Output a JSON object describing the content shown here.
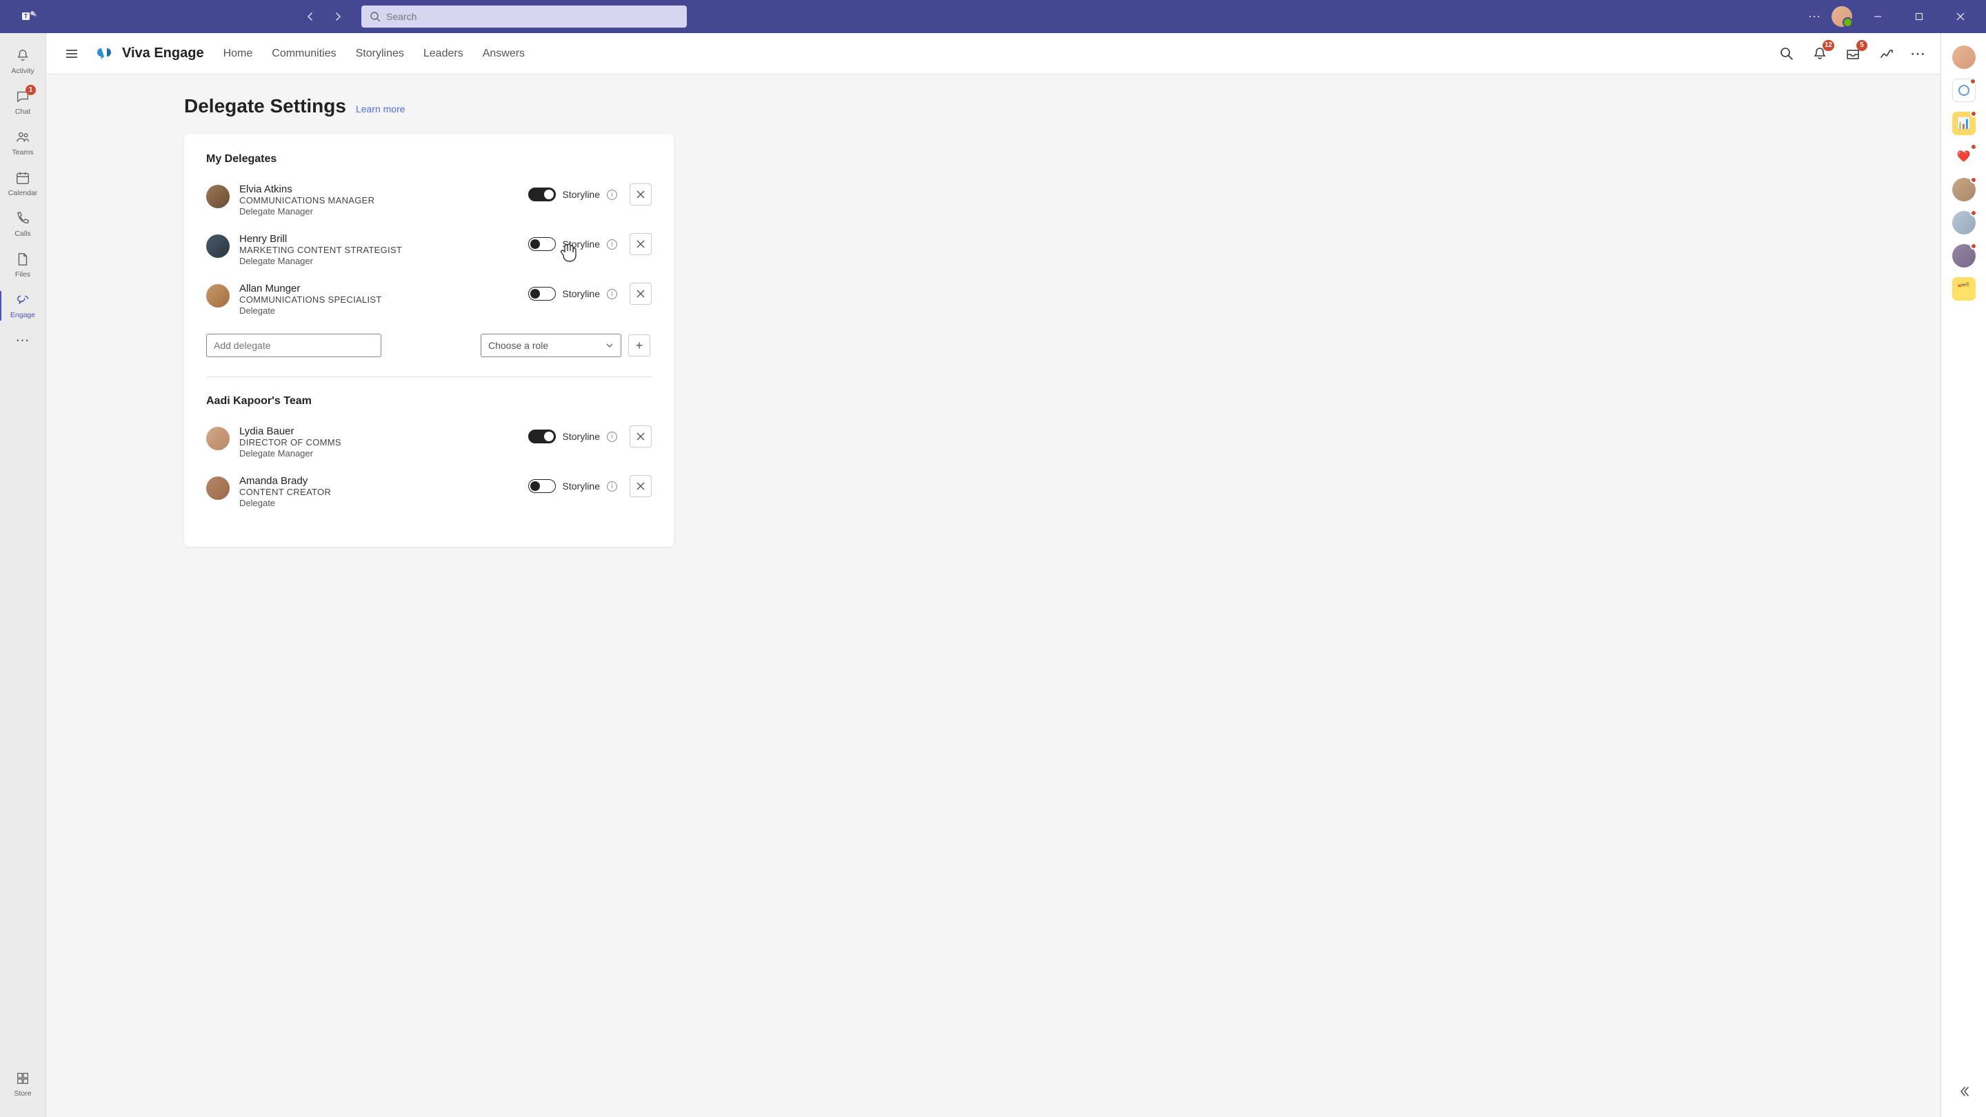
{
  "search": {
    "placeholder": "Search"
  },
  "rail": {
    "activity": "Activity",
    "chat": "Chat",
    "chat_badge": "1",
    "teams": "Teams",
    "calendar": "Calendar",
    "calls": "Calls",
    "files": "Files",
    "engage": "Engage",
    "store": "Store"
  },
  "header": {
    "app_title": "Viva Engage",
    "nav": {
      "home": "Home",
      "communities": "Communities",
      "storylines": "Storylines",
      "leaders": "Leaders",
      "answers": "Answers"
    },
    "bell_badge": "12",
    "inbox_badge": "5"
  },
  "page": {
    "title": "Delegate Settings",
    "learn_more": "Learn more"
  },
  "sections": {
    "my_delegates": "My Delegates",
    "team_title": "Aadi Kapoor's Team"
  },
  "delegates": [
    {
      "name": "Elvia Atkins",
      "title": "COMMUNICATIONS MANAGER",
      "role": "Delegate Manager",
      "storyline_on": true
    },
    {
      "name": "Henry Brill",
      "title": "MARKETING CONTENT STRATEGIST",
      "role": "Delegate Manager",
      "storyline_on": false
    },
    {
      "name": "Allan Munger",
      "title": "COMMUNICATIONS SPECIALIST",
      "role": "Delegate",
      "storyline_on": false
    }
  ],
  "team_delegates": [
    {
      "name": "Lydia Bauer",
      "title": "DIRECTOR OF COMMS",
      "role": "Delegate Manager",
      "storyline_on": true
    },
    {
      "name": "Amanda Brady",
      "title": "CONTENT CREATOR",
      "role": "Delegate",
      "storyline_on": false
    }
  ],
  "storyline_label": "Storyline",
  "add": {
    "placeholder": "Add delegate",
    "role_placeholder": "Choose a role"
  }
}
